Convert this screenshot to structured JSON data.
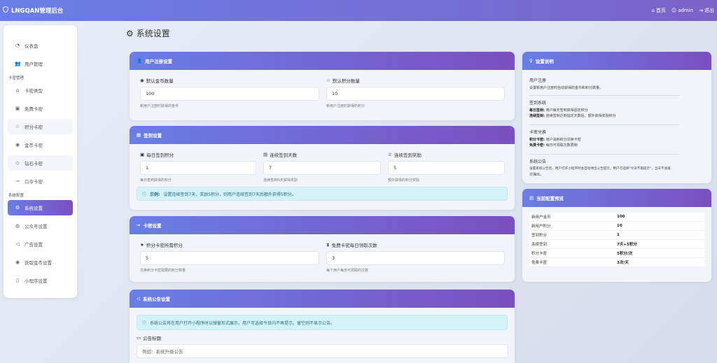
{
  "topbar": {
    "brand": "LNGQAN管理后台",
    "home": "首页",
    "user": "admin",
    "logout": "退出"
  },
  "sidebar": {
    "items_top": [
      {
        "label": "仪表盘",
        "icon": "dashboard-icon"
      },
      {
        "label": "用户管理",
        "icon": "users-icon"
      }
    ],
    "group_card": "卡密管理",
    "items_card": [
      {
        "label": "卡密类型",
        "icon": "tag-icon"
      },
      {
        "label": "免费卡密",
        "icon": "gift-icon"
      },
      {
        "label": "积分卡密",
        "icon": "star-icon"
      },
      {
        "label": "金币卡密",
        "icon": "coin-icon"
      },
      {
        "label": "钻石卡密",
        "icon": "diamond-icon"
      },
      {
        "label": "口令卡密",
        "icon": "key-icon"
      }
    ],
    "group_sys": "系统配置",
    "items_sys": [
      {
        "label": "系统设置",
        "icon": "gear-icon"
      },
      {
        "label": "公众号设置",
        "icon": "wechat-icon"
      },
      {
        "label": "广告设置",
        "icon": "megaphone-icon"
      },
      {
        "label": "获取金币设置",
        "icon": "coin-icon"
      },
      {
        "label": "小程序设置",
        "icon": "phone-icon"
      }
    ]
  },
  "page": {
    "title": "系统设置"
  },
  "register": {
    "title": "用户注册设置",
    "coins_label": "默认金币数量",
    "coins_value": "100",
    "coins_help": "新用户注册时获得的金币",
    "points_label": "默认积分数量",
    "points_value": "10",
    "points_help": "新用户注册时获得的积分"
  },
  "checkin": {
    "title": "签到设置",
    "daily_label": "每日签到积分",
    "daily_value": "1",
    "daily_help": "每日签到获得的积分",
    "days_label": "连续签到天数",
    "days_value": "7",
    "days_help": "连续签到N天获得奖励",
    "bonus_label": "连续签到奖励",
    "bonus_value": "5",
    "bonus_help": "额外获得的积分奖励",
    "example_label": "示例:",
    "example_text": "设置连续签到7天，奖励5积分，则用户连续签到7天后额外获得5积分。"
  },
  "cardkey": {
    "title": "卡密设置",
    "points_label": "积分卡密所需积分",
    "points_value": "5",
    "points_help": "兑换积分卡密需要的积分数量",
    "free_label": "免费卡密每日领取次数",
    "free_value": "3",
    "free_help": "每个用户每天可领取的次数"
  },
  "notice": {
    "title": "系统公告设置",
    "info": "系统公告将在用户打开小程序时以弹窗形式展示，用户可选择今日内不再提示。留空则不显示公告。",
    "title_label": "公告标题",
    "title_placeholder": "例如：系统升级公告"
  },
  "help": {
    "title": "设置说明",
    "sections": [
      {
        "title": "用户注册",
        "lines": [
          {
            "k": "",
            "v": "设置新用户注册时自动获得的金币和积分数量。"
          }
        ]
      },
      {
        "title": "签到系统",
        "lines": [
          {
            "k": "每日签到:",
            "v": "用户每天签到获得固定积分"
          },
          {
            "k": "连续签到:",
            "v": "连续签到达到指定天数后，额外获得奖励积分"
          }
        ]
      },
      {
        "title": "卡密兑换",
        "lines": [
          {
            "k": "积分卡密:",
            "v": "用户消耗积分兑换卡密"
          },
          {
            "k": "免费卡密:",
            "v": "每日可领取次数限制"
          }
        ]
      },
      {
        "title": "系统公告",
        "lines": [
          {
            "k": "",
            "v": "设置系统公告后，用户打开小程序时会自动弹出公告提示。用户可选择\"今日不再提示\"，当天不会再"
          },
          {
            "k": "",
            "v": "次弹出。"
          }
        ]
      }
    ]
  },
  "preview": {
    "title": "当前配置预览",
    "rows": [
      {
        "k": "新用户金币",
        "v": "100"
      },
      {
        "k": "新用户积分",
        "v": "10"
      },
      {
        "k": "签到积分",
        "v": "1"
      },
      {
        "k": "连续签到",
        "v": "7天+5积分"
      },
      {
        "k": "积分卡密",
        "v": "5积分/次"
      },
      {
        "k": "免费卡密",
        "v": "3次/天"
      }
    ]
  },
  "colors": {
    "accent_start": "#6a7ee6",
    "accent_end": "#7b4fbf",
    "info_bg": "#d4f2f8"
  }
}
